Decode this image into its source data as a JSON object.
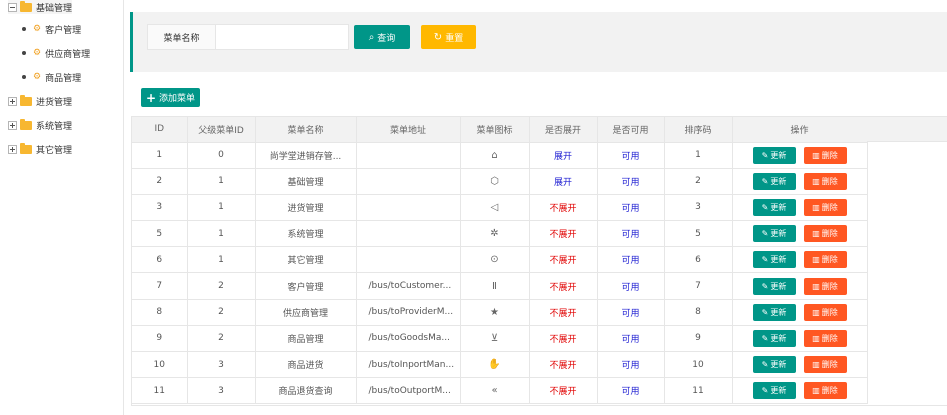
{
  "sidebar": {
    "groups": [
      {
        "label": "基础管理",
        "expanded": true,
        "children": [
          {
            "label": "客户管理"
          },
          {
            "label": "供应商管理"
          },
          {
            "label": "商品管理"
          }
        ]
      },
      {
        "label": "进货管理",
        "expanded": false
      },
      {
        "label": "系统管理",
        "expanded": false
      },
      {
        "label": "其它管理",
        "expanded": false
      }
    ]
  },
  "search": {
    "label": "菜单名称",
    "value": "",
    "placeholder": "",
    "query_label": "查询",
    "reset_label": "重置"
  },
  "toolbar": {
    "add_label": "添加菜单"
  },
  "table": {
    "columns": [
      "ID",
      "父级菜单ID",
      "菜单名称",
      "菜单地址",
      "菜单图标",
      "是否展开",
      "是否可用",
      "排序码",
      "操作"
    ],
    "update_label": "更新",
    "delete_label": "删除",
    "rows": [
      {
        "id": "1",
        "pid": "0",
        "name": "尚学堂进销存管...",
        "url": "",
        "icon": "home-icon",
        "glyph": "⌂",
        "open": "展开",
        "available": "可用",
        "order": "1"
      },
      {
        "id": "2",
        "pid": "1",
        "name": "基础管理",
        "url": "",
        "icon": "cube-icon",
        "glyph": "⬡",
        "open": "展开",
        "available": "可用",
        "order": "2"
      },
      {
        "id": "3",
        "pid": "1",
        "name": "进货管理",
        "url": "",
        "icon": "speaker-icon",
        "glyph": "◁",
        "open": "不展开",
        "available": "可用",
        "order": "3"
      },
      {
        "id": "5",
        "pid": "1",
        "name": "系统管理",
        "url": "",
        "icon": "gear-icon",
        "glyph": "✲",
        "open": "不展开",
        "available": "可用",
        "order": "5"
      },
      {
        "id": "6",
        "pid": "1",
        "name": "其它管理",
        "url": "",
        "icon": "circle-arrow-icon",
        "glyph": "⊙",
        "open": "不展开",
        "available": "可用",
        "order": "6"
      },
      {
        "id": "7",
        "pid": "2",
        "name": "客户管理",
        "url": "/bus/toCustomer...",
        "icon": "pause-circle-icon",
        "glyph": "Ⅱ",
        "open": "不展开",
        "available": "可用",
        "order": "7"
      },
      {
        "id": "8",
        "pid": "2",
        "name": "供应商管理",
        "url": "/bus/toProviderM...",
        "icon": "star-icon",
        "glyph": "★",
        "open": "不展开",
        "available": "可用",
        "order": "8"
      },
      {
        "id": "9",
        "pid": "2",
        "name": "商品管理",
        "url": "/bus/toGoodsMa...",
        "icon": "cart-icon",
        "glyph": "⊻",
        "open": "不展开",
        "available": "可用",
        "order": "9"
      },
      {
        "id": "10",
        "pid": "3",
        "name": "商品进货",
        "url": "/bus/toInportMan...",
        "icon": "hand-icon",
        "glyph": "✋",
        "open": "不展开",
        "available": "可用",
        "order": "10"
      },
      {
        "id": "11",
        "pid": "3",
        "name": "商品退货查询",
        "url": "/bus/toOutportM...",
        "icon": "double-left-icon",
        "glyph": "«",
        "open": "不展开",
        "available": "可用",
        "order": "11"
      }
    ]
  },
  "colors": {
    "primary": "#009688",
    "warning": "#ffb800",
    "danger": "#ff5722",
    "open_blue": "#1e1ed2",
    "closed_red": "#e00000"
  }
}
